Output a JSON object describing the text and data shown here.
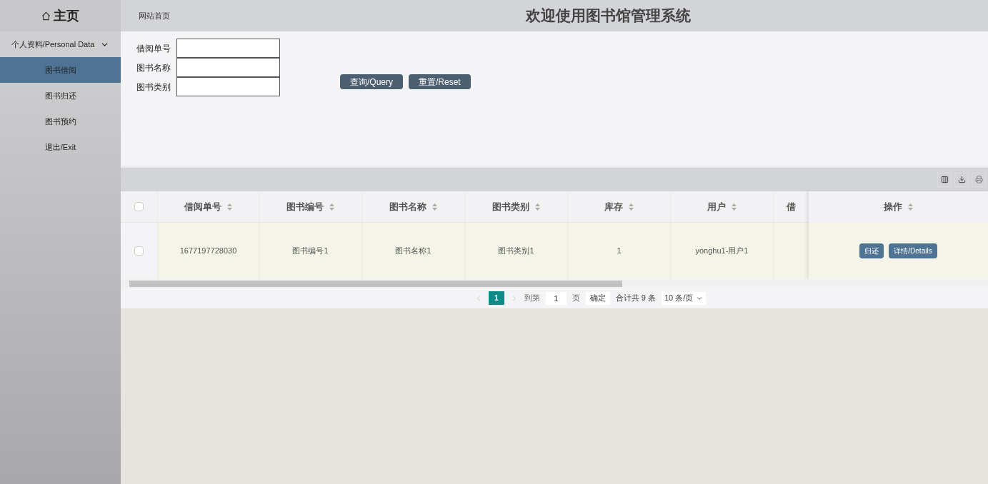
{
  "sidebar": {
    "home": "主页",
    "items": [
      {
        "label": "个人资料/Personal Data",
        "kind": "group",
        "selected": false,
        "expanded": false
      },
      {
        "label": "图书借阅",
        "kind": "link",
        "selected": true
      },
      {
        "label": "图书归还",
        "kind": "link",
        "selected": false
      },
      {
        "label": "图书预约",
        "kind": "link",
        "selected": false
      },
      {
        "label": "退出/Exit",
        "kind": "link",
        "selected": false
      }
    ]
  },
  "header": {
    "breadcrumb": "网站首页",
    "title": "欢迎使用图书馆管理系统"
  },
  "search": {
    "fields": [
      {
        "label": "借阅单号"
      },
      {
        "label": "图书名称"
      },
      {
        "label": "图书类别"
      }
    ],
    "buttons": [
      "查询/Query",
      "重置/Reset"
    ]
  },
  "table": {
    "columns": [
      "借阅单号",
      "图书编号",
      "图书名称",
      "图书类别",
      "库存",
      "用户",
      "借",
      "操作"
    ],
    "rows": [
      {
        "checked": false,
        "cells": [
          "1677197728030",
          "图书编号1",
          "图书名称1",
          "图书类别1",
          "1",
          "yonghu1-用户1",
          ""
        ],
        "actions": [
          "归还",
          "详情/Details"
        ]
      }
    ],
    "header_checked": false
  },
  "pagination": {
    "pages": [
      {
        "label": "1",
        "selected": true
      }
    ],
    "goto_label": "到第",
    "goto_value": "1",
    "page_unit": "页",
    "confirm": "确定",
    "total": "合计共 9 条",
    "page_size": "10 条/页"
  }
}
